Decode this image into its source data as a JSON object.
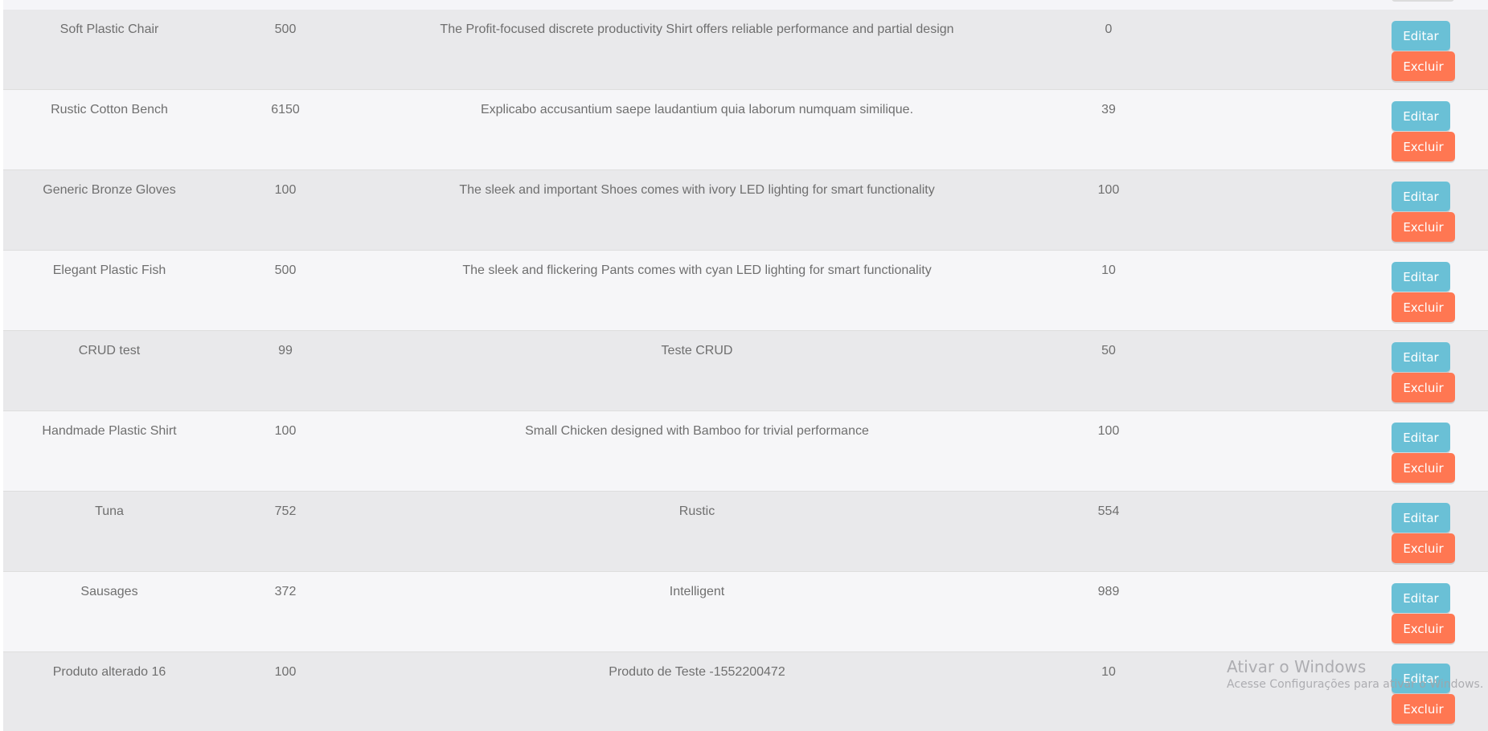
{
  "actions": {
    "edit_label": "Editar",
    "delete_label": "Excluir"
  },
  "colors": {
    "edit_button": "#6ac0d6",
    "delete_button": "#ff7752",
    "row_odd": "#e9e9eb",
    "row_even": "#f6f6f8",
    "text": "#6f6f6f"
  },
  "products": [
    {
      "name": "Soft Plastic Chair",
      "price": "500",
      "description": "The Profit-focused discrete productivity Shirt offers reliable performance and partial design",
      "quantity": "0"
    },
    {
      "name": "Rustic Cotton Bench",
      "price": "6150",
      "description": "Explicabo accusantium saepe laudantium quia laborum numquam similique.",
      "quantity": "39"
    },
    {
      "name": "Generic Bronze Gloves",
      "price": "100",
      "description": "The sleek and important Shoes comes with ivory LED lighting for smart functionality",
      "quantity": "100"
    },
    {
      "name": "Elegant Plastic Fish",
      "price": "500",
      "description": "The sleek and flickering Pants comes with cyan LED lighting for smart functionality",
      "quantity": "10"
    },
    {
      "name": "CRUD test",
      "price": "99",
      "description": "Teste CRUD",
      "quantity": "50"
    },
    {
      "name": "Handmade Plastic Shirt",
      "price": "100",
      "description": "Small Chicken designed with Bamboo for trivial performance",
      "quantity": "100"
    },
    {
      "name": "Tuna",
      "price": "752",
      "description": "Rustic",
      "quantity": "554"
    },
    {
      "name": "Sausages",
      "price": "372",
      "description": "Intelligent",
      "quantity": "989"
    },
    {
      "name": "Produto alterado 16",
      "price": "100",
      "description": "Produto de Teste -1552200472",
      "quantity": "10"
    }
  ],
  "watermark": {
    "title": "Ativar o Windows",
    "subtitle": "Acesse Configurações para ativar o Windows."
  }
}
